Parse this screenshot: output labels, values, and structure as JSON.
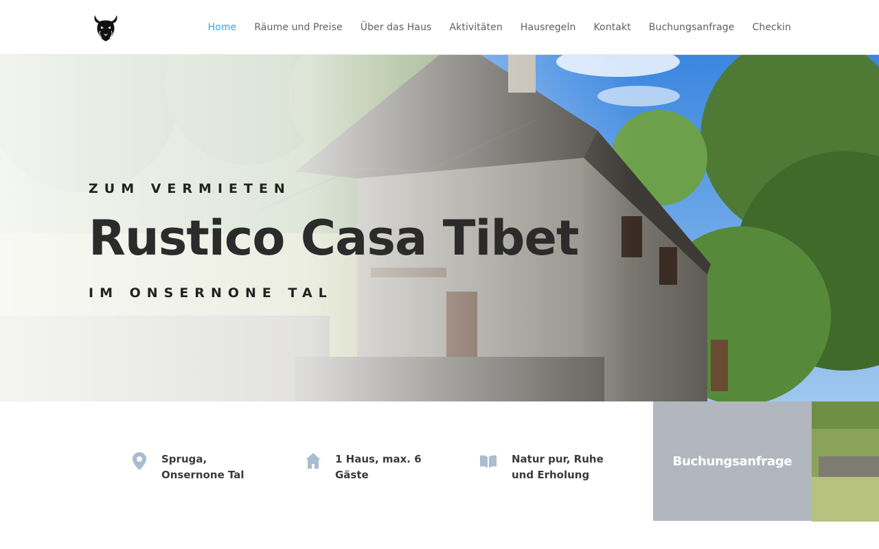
{
  "nav": {
    "items": [
      {
        "label": "Home",
        "active": true
      },
      {
        "label": "Räume und Preise",
        "active": false
      },
      {
        "label": "Über das Haus",
        "active": false
      },
      {
        "label": "Aktivitäten",
        "active": false
      },
      {
        "label": "Hausregeln",
        "active": false
      },
      {
        "label": "Kontakt",
        "active": false
      },
      {
        "label": "Buchungsanfrage",
        "active": false
      },
      {
        "label": "Checkin",
        "active": false
      }
    ],
    "logo_icon": "yak-head-logo"
  },
  "hero": {
    "eyebrow": "ZUM VERMIETEN",
    "title": "Rustico Casa Tibet",
    "subtitle": "IM ONSERNONE TAL"
  },
  "features": [
    {
      "icon": "map-pin-icon",
      "text": "Spruga, Onsernone Tal"
    },
    {
      "icon": "house-icon",
      "text": "1 Haus, max. 6 Gäste"
    },
    {
      "icon": "open-book-icon",
      "text": "Natur pur, Ruhe und Erholung"
    }
  ],
  "cta": {
    "label": "Buchungsanfrage"
  },
  "colors": {
    "accent": "#2ea3f2",
    "nav_text": "#5f5f5f",
    "heading": "#2b2b2b",
    "cta_bg": "#b2b7bf",
    "icon": "#a9bcd0"
  }
}
